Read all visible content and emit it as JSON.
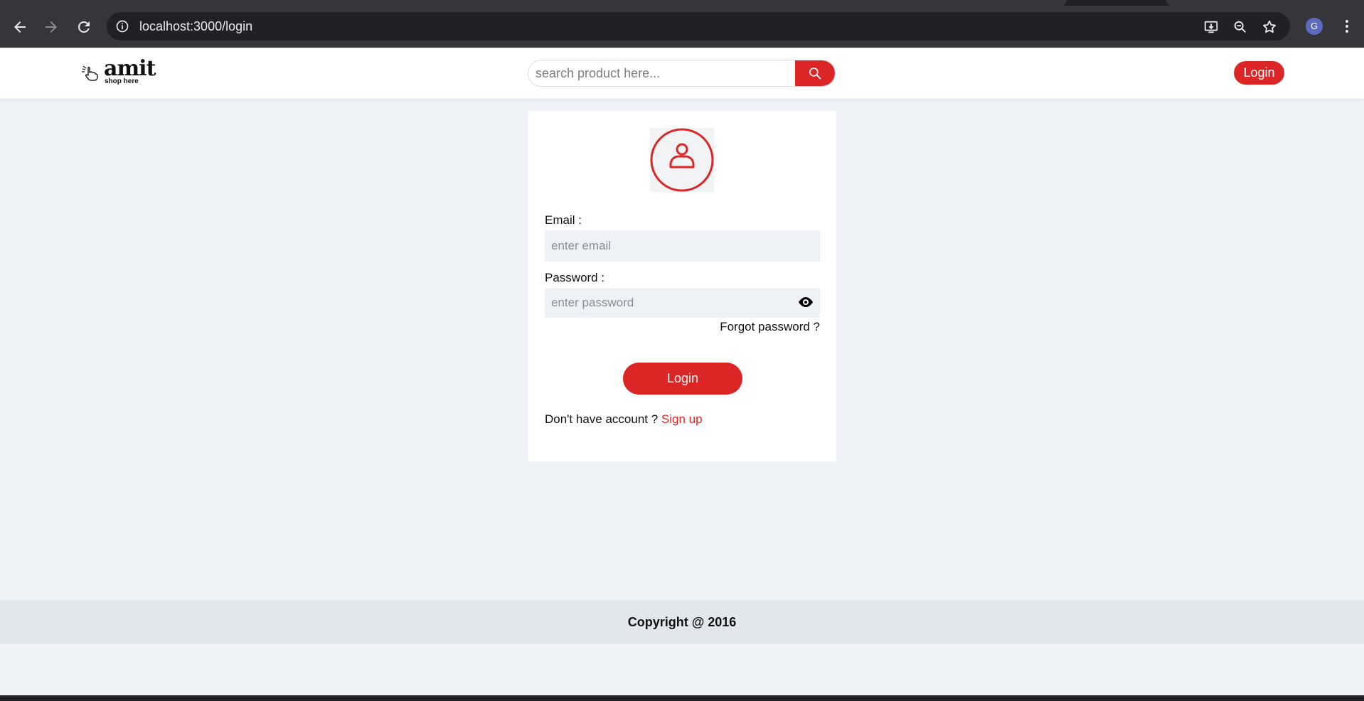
{
  "browser": {
    "url": "localhost:3000/login",
    "profile_initial": "G"
  },
  "header": {
    "logo_word": "amit",
    "logo_tagline": "shop here",
    "search_placeholder": "search product here...",
    "login_label": "Login"
  },
  "login_form": {
    "email_label": "Email :",
    "email_placeholder": "enter email",
    "password_label": "Password :",
    "password_placeholder": "enter password",
    "forgot_label": "Forgot password ?",
    "submit_label": "Login",
    "no_account_text": "Don't have account ?",
    "signup_label": "Sign up"
  },
  "footer": {
    "copyright": "Copyright @ 2016"
  },
  "colors": {
    "accent": "#dc2626",
    "page_bg": "#eff3f8",
    "footer_bg": "#e1e7ef"
  }
}
